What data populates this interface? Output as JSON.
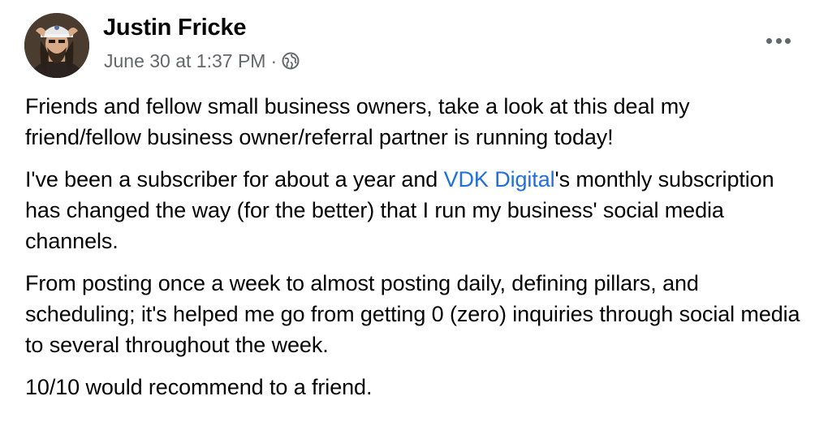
{
  "post": {
    "author": "Justin Fricke",
    "timestamp": "June 30 at 1:37 PM",
    "separator": "·",
    "audience_icon": "globe-icon",
    "more_icon": "more-options-icon",
    "paragraphs": [
      {
        "text": "Friends and fellow small business owners, take a look at this deal my friend/fellow business owner/referral partner is running today!"
      },
      {
        "before": "I've been a subscriber for about a year and ",
        "link": "VDK Digital",
        "after": "'s monthly subscription has changed the way (for the better) that I run my business' social media channels."
      },
      {
        "text": "From posting once a week to almost posting daily, defining pillars, and scheduling; it's helped me go from getting 0 (zero) inquiries through social media to several throughout the week."
      },
      {
        "text": "10/10 would recommend to a friend."
      }
    ]
  },
  "colors": {
    "text": "#050505",
    "secondary": "#65676b",
    "link": "#216fdb"
  }
}
